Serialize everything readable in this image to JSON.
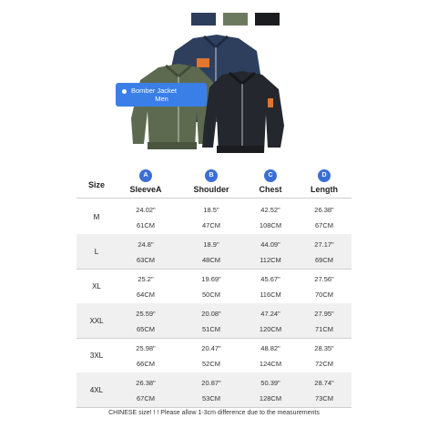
{
  "colors": {
    "swatch_navy": "#2c3e5c",
    "swatch_green": "#6b7a5e",
    "swatch_black": "#1a1c20",
    "badge": "#3b6fd6",
    "tag": "#3a7fe8",
    "row_shade": "#f0f0f0"
  },
  "tag": {
    "line1": "Bomber Jacket",
    "line2": "Men"
  },
  "table": {
    "size_header": "Size",
    "columns": [
      {
        "badge": "A",
        "label": "SleeveA"
      },
      {
        "badge": "B",
        "label": "Shoulder"
      },
      {
        "badge": "C",
        "label": "Chest"
      },
      {
        "badge": "D",
        "label": "Length"
      }
    ],
    "rows": [
      {
        "size": "M",
        "inch": [
          "24.02\"",
          "18.5\"",
          "42.52\"",
          "26.38\""
        ],
        "cm": [
          "61CM",
          "47CM",
          "108CM",
          "67CM"
        ]
      },
      {
        "size": "L",
        "inch": [
          "24.8\"",
          "18.9\"",
          "44.09\"",
          "27.17\""
        ],
        "cm": [
          "63CM",
          "48CM",
          "112CM",
          "69CM"
        ]
      },
      {
        "size": "XL",
        "inch": [
          "25.2\"",
          "19.69\"",
          "45.67\"",
          "27.56\""
        ],
        "cm": [
          "64CM",
          "50CM",
          "116CM",
          "70CM"
        ]
      },
      {
        "size": "XXL",
        "inch": [
          "25.59\"",
          "20.08\"",
          "47.24\"",
          "27.95\""
        ],
        "cm": [
          "65CM",
          "51CM",
          "120CM",
          "71CM"
        ]
      },
      {
        "size": "3XL",
        "inch": [
          "25.98\"",
          "20.47\"",
          "48.82\"",
          "28.35\""
        ],
        "cm": [
          "66CM",
          "52CM",
          "124CM",
          "72CM"
        ]
      },
      {
        "size": "4XL",
        "inch": [
          "26.38\"",
          "20.87\"",
          "50.39\"",
          "28.74\""
        ],
        "cm": [
          "67CM",
          "53CM",
          "128CM",
          "73CM"
        ]
      }
    ]
  },
  "note": "CHINESE size! ! ! Please allow 1-3cm difference due to the measurements"
}
